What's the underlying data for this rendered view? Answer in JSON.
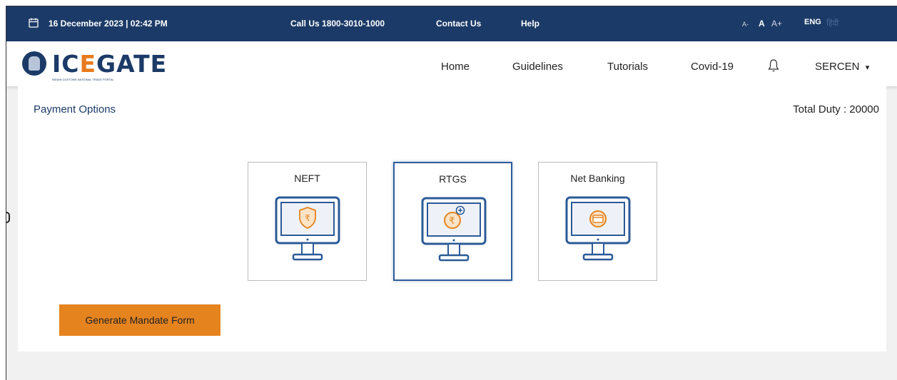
{
  "topbar": {
    "datetime": "16 December 2023 | 02:42 PM",
    "call_us": "Call Us  1800-3010-1000",
    "contact_us": "Contact Us",
    "help": "Help",
    "font_small": "A-",
    "font_normal": "A",
    "font_large": "A+",
    "lang_eng": "ENG",
    "lang_hindi": "हिंदी"
  },
  "brand": {
    "logo_prefix": "IC",
    "logo_accent": "E",
    "logo_suffix": "GATE",
    "logo_tagline": "INDIAN CUSTOMS NATIONAL TRADE PORTAL"
  },
  "nav": {
    "home": "Home",
    "guidelines": "Guidelines",
    "tutorials": "Tutorials",
    "covid": "Covid-19",
    "user": "SERCEN",
    "user_caret": "▾"
  },
  "main": {
    "payment_options_label": "Payment Options",
    "total_duty": "Total Duty : 20000",
    "options": [
      {
        "label": "NEFT",
        "icon": "monitor-rupee-shield-icon"
      },
      {
        "label": "RTGS",
        "icon": "monitor-rupee-coin-plus-icon",
        "selected": true
      },
      {
        "label": "Net Banking",
        "icon": "monitor-card-icon"
      }
    ],
    "generate_button": "Generate Mandate Form"
  },
  "colors": {
    "topbar_bg": "#1b3a67",
    "accent_orange": "#e5831f",
    "icon_blue": "#2b5a97",
    "selected_border": "#2e5c9c"
  }
}
